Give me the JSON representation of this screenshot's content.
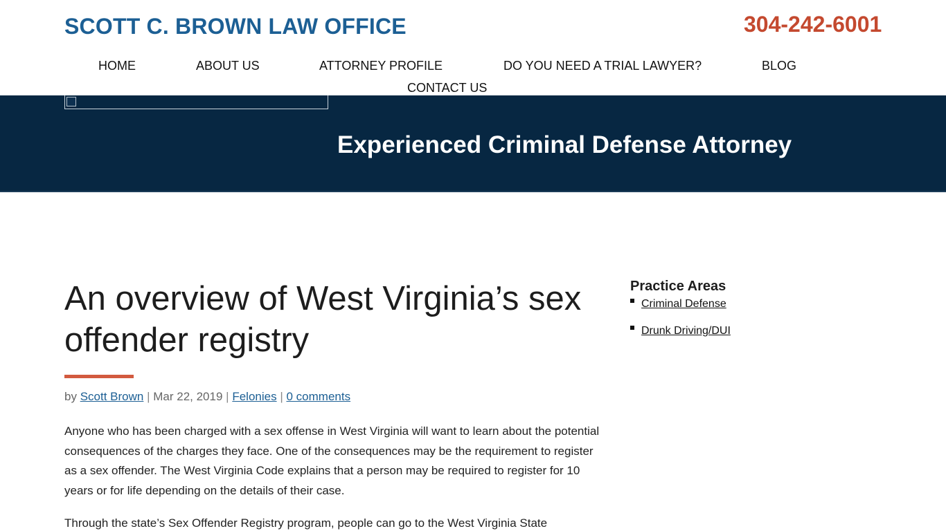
{
  "header": {
    "logo_text": "SCOTT C. BROWN LAW OFFICE",
    "phone": "304-242-6001"
  },
  "nav": {
    "items": [
      {
        "label": "HOME"
      },
      {
        "label": "ABOUT US"
      },
      {
        "label": "ATTORNEY PROFILE"
      },
      {
        "label": "DO YOU NEED A TRIAL LAWYER?"
      },
      {
        "label": "BLOG"
      },
      {
        "label": "CONTACT US"
      }
    ]
  },
  "hero": {
    "title": "Experienced Criminal Defense Attorney"
  },
  "article": {
    "title": "An overview of West Virginia’s sex offender registry",
    "meta": {
      "by": "by",
      "author": "Scott Brown",
      "date": "Mar 22, 2019",
      "category": "Felonies",
      "comments": "0 comments"
    },
    "paragraphs": [
      "Anyone who has been charged with a sex offense in West Virginia will want to learn about the potential consequences of the charges they face. One of the consequences may be the requirement to register as a sex offender. The West Virginia Code explains that a person may be required to register for 10 years or for life depending on the details of their case.",
      "Through the state’s Sex Offender Registry program, people can go to the West Virginia State"
    ]
  },
  "sidebar": {
    "title": "Practice Areas",
    "items": [
      {
        "label": "Criminal Defense"
      },
      {
        "label": "Drunk Driving/DUI"
      }
    ]
  },
  "colors": {
    "brand_blue": "#1c5f94",
    "phone_accent": "#c4492f",
    "banner_navy": "#072742",
    "underline_accent": "#d25a3f"
  }
}
